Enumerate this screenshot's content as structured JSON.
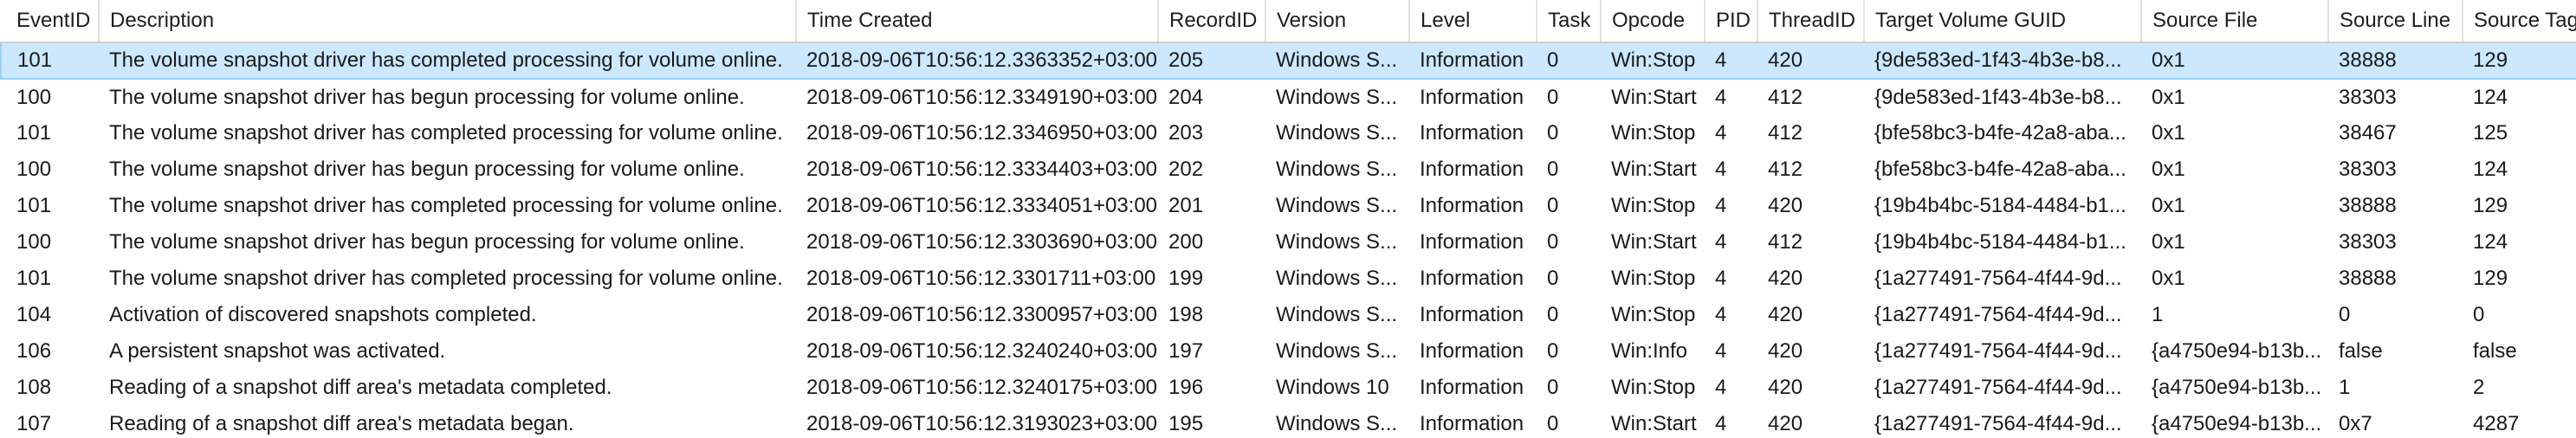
{
  "columns": [
    "EventID",
    "Description",
    "Time Created",
    "RecordID",
    "Version",
    "Level",
    "Task",
    "Opcode",
    "PID",
    "ThreadID",
    "Target Volume GUID",
    "Source File",
    "Source Line",
    "Source Tag"
  ],
  "selected_row": 0,
  "rows": [
    [
      "101",
      "The volume snapshot driver has completed processing for volume online.",
      "2018-09-06T10:56:12.3363352+03:00",
      "205",
      "Windows S...",
      "Information",
      "0",
      "Win:Stop",
      "4",
      "420",
      "{9de583ed-1f43-4b3e-b8...",
      "0x1",
      "38888",
      "129"
    ],
    [
      "100",
      "The volume snapshot driver has begun processing for volume online.",
      "2018-09-06T10:56:12.3349190+03:00",
      "204",
      "Windows S...",
      "Information",
      "0",
      "Win:Start",
      "4",
      "412",
      "{9de583ed-1f43-4b3e-b8...",
      "0x1",
      "38303",
      "124"
    ],
    [
      "101",
      "The volume snapshot driver has completed processing for volume online.",
      "2018-09-06T10:56:12.3346950+03:00",
      "203",
      "Windows S...",
      "Information",
      "0",
      "Win:Stop",
      "4",
      "412",
      "{bfe58bc3-b4fe-42a8-aba...",
      "0x1",
      "38467",
      "125"
    ],
    [
      "100",
      "The volume snapshot driver has begun processing for volume online.",
      "2018-09-06T10:56:12.3334403+03:00",
      "202",
      "Windows S...",
      "Information",
      "0",
      "Win:Start",
      "4",
      "412",
      "{bfe58bc3-b4fe-42a8-aba...",
      "0x1",
      "38303",
      "124"
    ],
    [
      "101",
      "The volume snapshot driver has completed processing for volume online.",
      "2018-09-06T10:56:12.3334051+03:00",
      "201",
      "Windows S...",
      "Information",
      "0",
      "Win:Stop",
      "4",
      "420",
      "{19b4b4bc-5184-4484-b1...",
      "0x1",
      "38888",
      "129"
    ],
    [
      "100",
      "The volume snapshot driver has begun processing for volume online.",
      "2018-09-06T10:56:12.3303690+03:00",
      "200",
      "Windows S...",
      "Information",
      "0",
      "Win:Start",
      "4",
      "412",
      "{19b4b4bc-5184-4484-b1...",
      "0x1",
      "38303",
      "124"
    ],
    [
      "101",
      "The volume snapshot driver has completed processing for volume online.",
      "2018-09-06T10:56:12.3301711+03:00",
      "199",
      "Windows S...",
      "Information",
      "0",
      "Win:Stop",
      "4",
      "420",
      "{1a277491-7564-4f44-9d...",
      "0x1",
      "38888",
      "129"
    ],
    [
      "104",
      "Activation of discovered snapshots completed.",
      "2018-09-06T10:56:12.3300957+03:00",
      "198",
      "Windows S...",
      "Information",
      "0",
      "Win:Stop",
      "4",
      "420",
      "{1a277491-7564-4f44-9d...",
      "1",
      "0",
      "0"
    ],
    [
      "106",
      "A persistent snapshot was activated.",
      "2018-09-06T10:56:12.3240240+03:00",
      "197",
      "Windows S...",
      "Information",
      "0",
      "Win:Info",
      "4",
      "420",
      "{1a277491-7564-4f44-9d...",
      "{a4750e94-b13b...",
      "false",
      "false"
    ],
    [
      "108",
      "Reading of a snapshot diff area's metadata completed.",
      "2018-09-06T10:56:12.3240175+03:00",
      "196",
      "Windows 10",
      "Information",
      "0",
      "Win:Stop",
      "4",
      "420",
      "{1a277491-7564-4f44-9d...",
      "{a4750e94-b13b...",
      "1",
      "2"
    ],
    [
      "107",
      "Reading of a snapshot diff area's metadata began.",
      "2018-09-06T10:56:12.3193023+03:00",
      "195",
      "Windows S...",
      "Information",
      "0",
      "Win:Start",
      "4",
      "420",
      "{1a277491-7564-4f44-9d...",
      "{a4750e94-b13b...",
      "0x7",
      "4287"
    ]
  ]
}
